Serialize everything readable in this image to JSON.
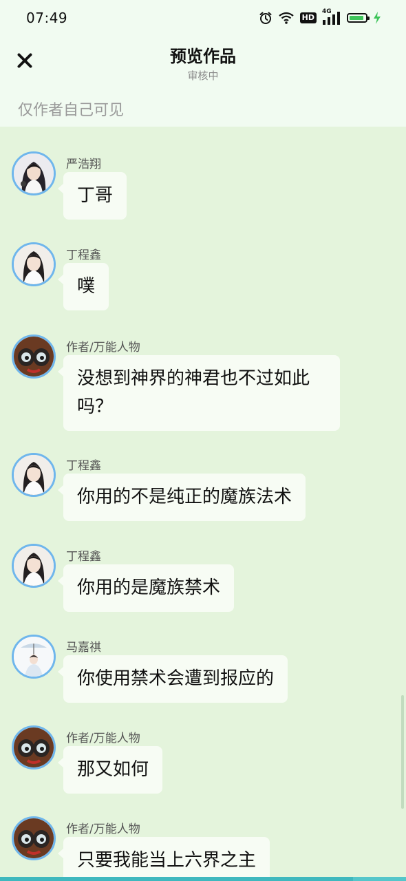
{
  "status_bar": {
    "time": "07:49",
    "icons": [
      "alarm-icon",
      "wifi-icon",
      "hd-icon",
      "signal-4g-icon",
      "battery-icon",
      "charging-icon"
    ],
    "hd_label": "HD",
    "network_label": "4G",
    "battery_level": 0.9
  },
  "header": {
    "title": "预览作品",
    "subtitle": "审核中",
    "close_icon": "close-icon"
  },
  "notice": "仅作者自己可见",
  "messages": [
    {
      "sender": "严浩翔",
      "text": "丁哥",
      "avatar": "avatar-yan"
    },
    {
      "sender": "丁程鑫",
      "text": "噗",
      "avatar": "avatar-ding"
    },
    {
      "sender": "作者/万能人物",
      "text": "没想到神界的神君也不过如此吗？",
      "avatar": "avatar-author"
    },
    {
      "sender": "丁程鑫",
      "text": "你用的不是纯正的魔族法术",
      "avatar": "avatar-ding"
    },
    {
      "sender": "丁程鑫",
      "text": "你用的是魔族禁术",
      "avatar": "avatar-ding"
    },
    {
      "sender": "马嘉祺",
      "text": "你使用禁术会遭到报应的",
      "avatar": "avatar-ma"
    },
    {
      "sender": "作者/万能人物",
      "text": "那又如何",
      "avatar": "avatar-author"
    },
    {
      "sender": "作者/万能人物",
      "text": "只要我能当上六界之主",
      "avatar": "avatar-author"
    }
  ],
  "colors": {
    "background": "#e4f4dc",
    "header_bg": "#f1fbf1",
    "bubble_bg": "#f7fcf4",
    "avatar_ring": "#6fb6ec",
    "accent_strip": "#55c6ca"
  },
  "bottom_progress": 0.87
}
